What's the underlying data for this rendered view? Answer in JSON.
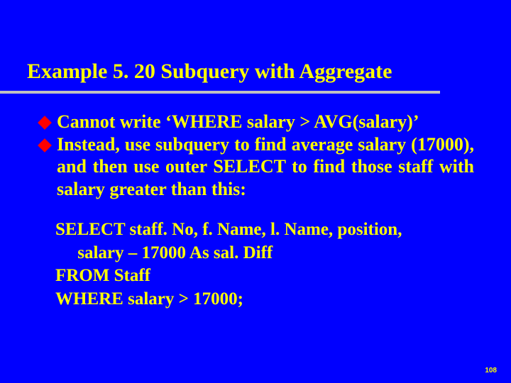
{
  "title": "Example 5. 20  Subquery with Aggregate",
  "bullets": [
    {
      "text": "Cannot write ‘WHERE salary > AVG(salary)’"
    },
    {
      "text": "Instead, use subquery to find average salary (17000), and then use outer SELECT to find those staff with salary greater than this:"
    }
  ],
  "code": {
    "line1": "SELECT staff. No, f. Name, l. Name, position,",
    "line2": "     salary – 17000 As sal. Diff",
    "line3": "FROM Staff",
    "line4": "WHERE salary > 17000;"
  },
  "page_number": "108"
}
